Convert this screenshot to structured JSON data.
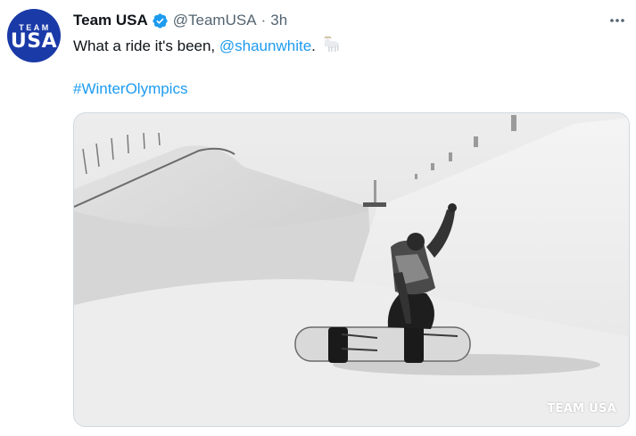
{
  "tweet": {
    "avatar": {
      "line1": "TEAM",
      "line2": "USA",
      "bg_color": "#1a3aa8"
    },
    "author": {
      "display_name": "Team USA",
      "handle": "@TeamUSA",
      "separator": "·",
      "time": "3h",
      "verified": true,
      "verified_color": "#1d9bf0"
    },
    "more_icon": "more-horizontal-icon",
    "text": {
      "before_mention": "What a ride it's been, ",
      "mention": "@shaunwhite",
      "after_mention": ".",
      "emoji": "goat-emoji",
      "hashtag": "#WinterOlympics"
    },
    "media": {
      "description_icon": "snowboarder-photo",
      "watermark": "TEAM USA"
    },
    "link_color": "#1d9bf0"
  }
}
